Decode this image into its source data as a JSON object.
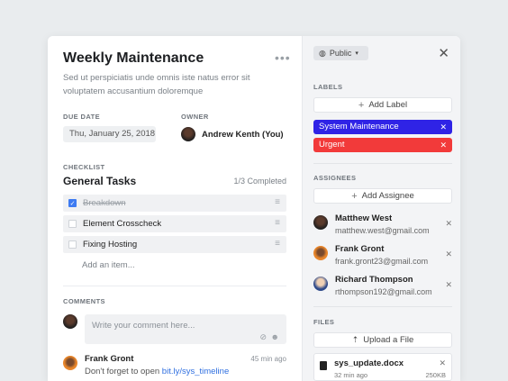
{
  "card": {
    "title": "Weekly Maintenance",
    "more_icon": "more-horizontal-icon",
    "description": "Sed ut perspiciatis unde omnis iste natus error sit voluptatem accusantium doloremque",
    "due_date_label": "DUE DATE",
    "due_date_value": "Thu, January 25, 2018",
    "owner_label": "OWNER",
    "owner_name": "Andrew Kenth (You)"
  },
  "checklist": {
    "label": "CHECKLIST",
    "title": "General Tasks",
    "completed": "1/3 Completed",
    "items": [
      {
        "text": "Breakdown",
        "checked": true
      },
      {
        "text": "Element Crosscheck",
        "checked": false
      },
      {
        "text": "Fixing Hosting",
        "checked": false
      }
    ],
    "add_item": "Add an item..."
  },
  "comments": {
    "label": "COMMENTS",
    "placeholder": "Write your comment here...",
    "entries": [
      {
        "author": "Frank Gront",
        "time": "45 min ago",
        "text": "Don't forget to open ",
        "link": "bit.ly/sys_timeline"
      }
    ]
  },
  "panel": {
    "visibility": "Public",
    "labels_label": "LABELS",
    "add_label": "Add Label",
    "tags": [
      {
        "text": "System Maintenance",
        "color": "#2f23e6"
      },
      {
        "text": "Urgent",
        "color": "#f23a3a"
      }
    ],
    "assignees_label": "ASSIGNEES",
    "add_assignee": "Add Assignee",
    "assignees": [
      {
        "name": "Matthew West",
        "email": "matthew.west@gmail.com"
      },
      {
        "name": "Frank Gront",
        "email": "frank.gront23@gmail.com"
      },
      {
        "name": "Richard Thompson",
        "email": "rthompson192@gmail.com"
      }
    ],
    "files_label": "FILES",
    "upload": "Upload a File",
    "file": {
      "name": "sys_update.docx",
      "time": "32 min ago",
      "size": "250KB"
    }
  }
}
